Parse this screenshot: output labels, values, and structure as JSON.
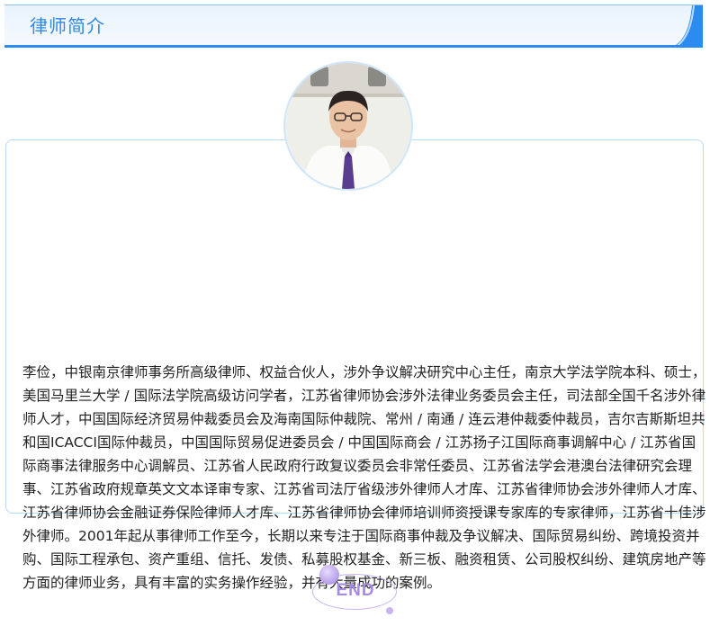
{
  "header": {
    "title": "律师简介"
  },
  "profile": {
    "avatar_icon": "lawyer-portrait",
    "bio": "李俭，中银南京律师事务所高级律师、权益合伙人，涉外争议解决研究中心主任，南京大学法学院本科、硕士，美国马里兰大学 / 国际法学院高级访问学者，江苏省律师协会涉外法律业务委员会主任，司法部全国千名涉外律师人才，中国国际经济贸易仲裁委员会及海南国际仲裁院、常州 / 南通 / 连云港仲裁委仲裁员，吉尔吉斯斯坦共和国ICACCI国际仲裁员，中国国际贸易促进委员会 / 中国国际商会 / 江苏扬子江国际商事调解中心 / 江苏省国际商事法律服务中心调解员、江苏省人民政府行政复议委员会非常任委员、江苏省法学会港澳台法律研究会理事、江苏省政府规章英文文本译审专家、江苏省司法厅省级涉外律师人才库、江苏省律师协会涉外律师人才库、江苏省律师协会金融证券保险律师人才库、江苏省律师协会律师培训师资授课专家库的专家律师，江苏省十佳涉外律师。2001年起从事律师工作至今，长期以来专注于国际商事仲裁及争议解决、国际贸易纠纷、跨境投资并购、国际工程承包、资产重组、信托、发债、私募股权基金、新三板、融资租赁、公司股权纠纷、建筑房地产等方面的律师业务，具有丰富的实务操作经验，并有大量成功的案例。"
  },
  "footer": {
    "end_label": "END"
  },
  "colors": {
    "accent": "#2c8bf0",
    "title": "#2f87e8",
    "card_border": "#b9dcf6",
    "end_purple": "#a58ae6"
  }
}
